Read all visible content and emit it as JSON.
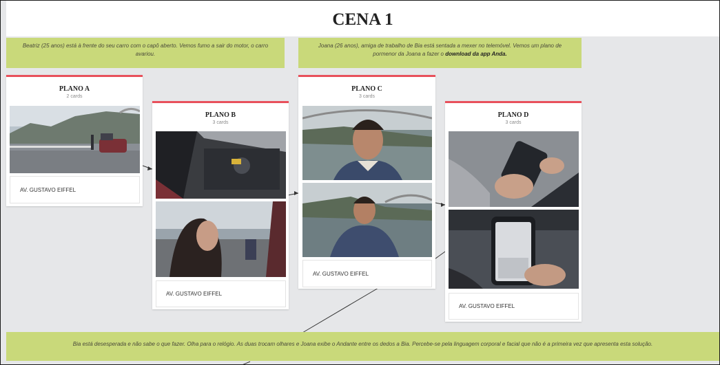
{
  "header": {
    "title": "CENA 1"
  },
  "notes": {
    "top_left": "Beatriz (25 anos) está à frente do seu carro com o capô aberto. Vemos fumo a sair do motor, o carro avariou.",
    "top_right_text": "Joana (26 anos), amiga de trabalho de Bia está sentada a mexer no telemóvel. Vemos um plano de pormenor da Joana a fazer o",
    "top_right_bold": "download da app Anda.",
    "bottom": "Bia está desesperada e não sabe o que fazer. Olha para o relógio. As duas trocam olhares e Joana exibe o Andante entre os dedos a Bia. Percebe-se pela linguagem corporal e facial que não é a primeira vez que apresenta esta solução."
  },
  "cards": [
    {
      "title": "PLANO A",
      "count": "2 cards",
      "location": "AV. GUSTAVO EIFFEL",
      "images": [
        "street-car-hood-photo"
      ]
    },
    {
      "title": "PLANO B",
      "count": "3 cards",
      "location": "AV. GUSTAVO EIFFEL",
      "images": [
        "engine-smoke-photo",
        "woman-watching-photo"
      ]
    },
    {
      "title": "PLANO C",
      "count": "3 cards",
      "location": "AV. GUSTAVO EIFFEL",
      "images": [
        "man-river-closeup-photo",
        "man-looking-down-photo"
      ]
    },
    {
      "title": "PLANO D",
      "count": "3 cards",
      "location": "AV. GUSTAVO EIFFEL",
      "images": [
        "hands-phone-photo",
        "phone-screen-photo"
      ]
    }
  ],
  "colors": {
    "accent": "#e8505b",
    "note_bg": "#c9d97a",
    "canvas_bg": "#e6e7e9"
  }
}
